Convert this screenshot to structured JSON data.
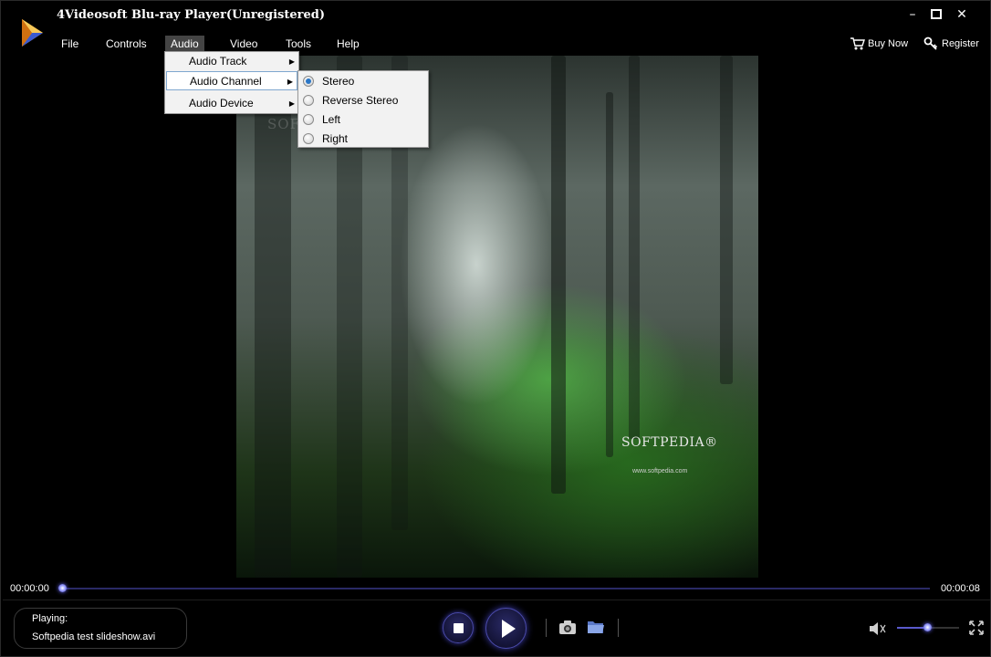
{
  "window": {
    "title": "4Videosoft Blu-ray Player(Unregistered)",
    "controls": {
      "minimize": "–",
      "maximize": "□",
      "close": "✕"
    }
  },
  "menubar": {
    "items": [
      {
        "label": "File"
      },
      {
        "label": "Controls"
      },
      {
        "label": "Audio"
      },
      {
        "label": "Video"
      },
      {
        "label": "Tools"
      },
      {
        "label": "Help"
      }
    ],
    "buy_now": "Buy Now",
    "register": "Register"
  },
  "audio_menu": {
    "items": [
      {
        "label": "Audio Track",
        "has_submenu": true
      },
      {
        "label": "Audio Channel",
        "has_submenu": true,
        "highlighted": true
      },
      {
        "label": "Audio Device",
        "has_submenu": true
      }
    ]
  },
  "audio_channel_submenu": {
    "items": [
      {
        "label": "Stereo",
        "checked": true
      },
      {
        "label": "Reverse Stereo",
        "checked": false
      },
      {
        "label": "Left",
        "checked": false
      },
      {
        "label": "Right",
        "checked": false
      }
    ]
  },
  "video": {
    "watermark": "SOFTPEDIA",
    "brand": "SOFTPEDIA®",
    "url": "www.softpedia.com"
  },
  "playback": {
    "current_time": "00:00:00",
    "total_time": "00:00:08",
    "progress": 0.0,
    "now_playing_label": "Playing:",
    "file_name": "Softpedia test slideshow.avi",
    "volume": 0.5
  },
  "icons": {
    "app_logo": "play-triangle-logo",
    "stop": "stop-icon",
    "play": "play-icon",
    "snapshot": "camera-icon",
    "open": "folder-icon",
    "volume": "speaker-icon",
    "fullscreen": "fullscreen-icon",
    "buy": "cart-icon",
    "register": "key-icon"
  },
  "colors": {
    "accent": "#3a3aaa",
    "menu_bg": "#f2f2f2",
    "highlight_border": "#7fa7cf",
    "radio_checked": "#2a77c7"
  }
}
